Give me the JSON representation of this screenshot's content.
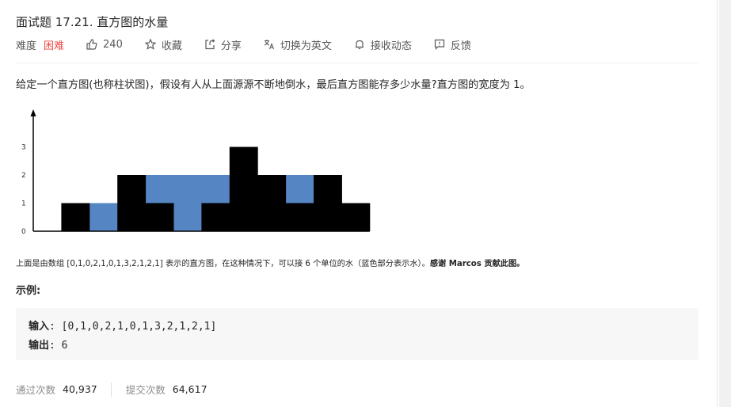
{
  "problem": {
    "title": "面试题 17.21. 直方图的水量",
    "difficulty_label": "难度",
    "difficulty_value": "困难",
    "likes": "240",
    "favorite_label": "收藏",
    "share_label": "分享",
    "switch_lang_label": "切换为英文",
    "subscribe_label": "接收动态",
    "feedback_label": "反馈"
  },
  "description": "给定一个直方图(也称柱状图)，假设有人从上面源源不断地倒水，最后直方图能存多少水量?直方图的宽度为 1。",
  "caption": {
    "text": "上面是由数组 [0,1,0,2,1,0,1,3,2,1,2,1] 表示的直方图，在这种情况下，可以接 6 个单位的水（蓝色部分表示水）。",
    "thanks": "感谢 Marcos 贡献此图。"
  },
  "example": {
    "heading": "示例:",
    "input_label": "输入",
    "input_value": ": [0,1,0,2,1,0,1,3,2,1,2,1]",
    "output_label": "输出",
    "output_value": ": 6"
  },
  "stats": {
    "accepted_label": "通过次数",
    "accepted_value": "40,937",
    "submissions_label": "提交次数",
    "submissions_value": "64,617"
  },
  "chart_data": {
    "type": "bar",
    "heights": [
      0,
      1,
      0,
      2,
      1,
      0,
      1,
      3,
      2,
      1,
      2,
      1
    ],
    "water": [
      0,
      0,
      1,
      0,
      1,
      2,
      1,
      0,
      0,
      1,
      0,
      0
    ],
    "y_ticks": [
      "0",
      "1",
      "2",
      "3"
    ],
    "ylim": [
      0,
      4
    ],
    "colors": {
      "bar": "#000000",
      "water": "#5585c2",
      "axis": "#000000"
    }
  }
}
